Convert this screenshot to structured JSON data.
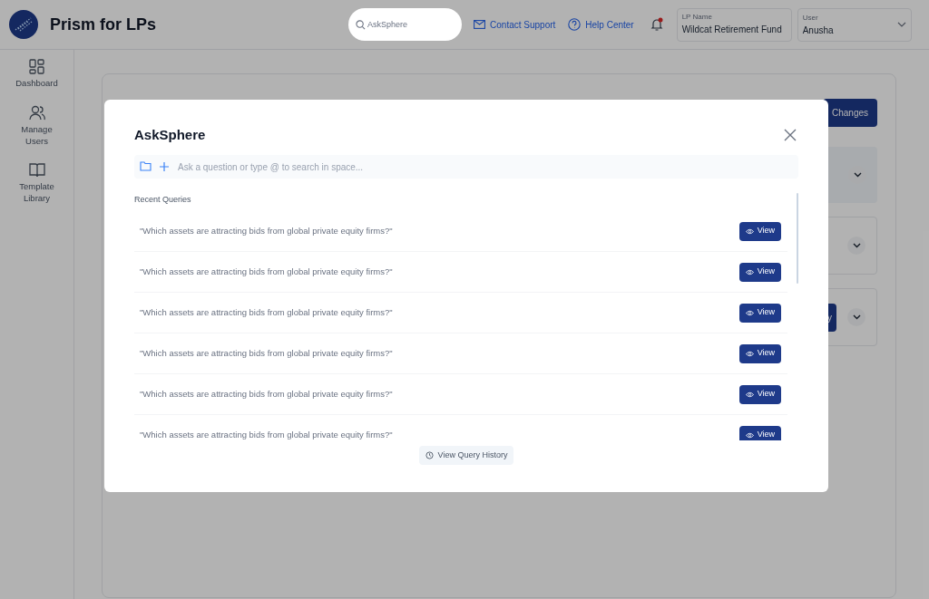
{
  "app": {
    "title": "Prism for LPs"
  },
  "header": {
    "search": {
      "placeholder": "AskSphere"
    },
    "links": [
      {
        "label": "Contact Support",
        "kind": "mail"
      },
      {
        "label": "Help Center",
        "kind": "help"
      }
    ],
    "notifications": {
      "unread": true
    },
    "lp_name": {
      "label": "LP Name",
      "value": "Wildcat Retirement Fund"
    },
    "user": {
      "label": "User",
      "value": "Anusha"
    }
  },
  "sidebar": {
    "items": [
      {
        "label": "Dashboard",
        "kind": "grid"
      },
      {
        "label": "Manage Users",
        "kind": "users"
      },
      {
        "label": "Template Library",
        "kind": "book"
      }
    ]
  },
  "page": {
    "save_button": "Changes",
    "sections": [
      {
        "highlighted": true
      },
      {
        "highlighted": false
      },
      {
        "highlighted": false,
        "button": "y"
      }
    ]
  },
  "modal": {
    "title": "AskSphere",
    "input": {
      "placeholder": "Ask a question or type @ to search in space..."
    },
    "recent_label": "Recent Queries",
    "queries": [
      {
        "text": "\"Which assets are attracting bids from global private equity firms?\"",
        "action": "View"
      },
      {
        "text": "\"Which assets are attracting bids from global private equity firms?\"",
        "action": "View"
      },
      {
        "text": "\"Which assets are attracting bids from global private equity firms?\"",
        "action": "View"
      },
      {
        "text": "\"Which assets are attracting bids from global private equity firms?\"",
        "action": "View"
      },
      {
        "text": "\"Which assets are attracting bids from global private equity firms?\"",
        "action": "View"
      },
      {
        "text": "\"Which assets are attracting bids from global private equity firms?\"",
        "action": "View"
      }
    ],
    "history_button": "View Query History"
  }
}
